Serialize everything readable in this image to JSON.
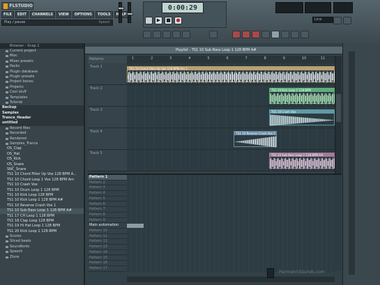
{
  "app": {
    "logo": "FLSTUDIO"
  },
  "menu": [
    "FILE",
    "EDIT",
    "CHANNELS",
    "VIEW",
    "OPTIONS",
    "TOOLS",
    "HELP"
  ],
  "hint_bar": {
    "text": "Play / pause",
    "value": "Speed"
  },
  "transport": {
    "time": "0:00:29",
    "play_symbol": "▶",
    "stop_symbol": "■",
    "record_symbol": "●"
  },
  "line_label": "Line",
  "browser": {
    "header": "Browser - Snap 1",
    "items": [
      {
        "t": "Current project",
        "kind": "folder"
      },
      {
        "t": "Misc",
        "kind": "folder"
      },
      {
        "t": "Mixer presets",
        "kind": "folder"
      },
      {
        "t": "Packs",
        "kind": "folder"
      },
      {
        "t": "Plugin database",
        "kind": "folder"
      },
      {
        "t": "Plugin presets",
        "kind": "folder"
      },
      {
        "t": "Project bones",
        "kind": "folder"
      },
      {
        "t": "Projects",
        "kind": "folder"
      },
      {
        "t": "Cool stuff",
        "kind": "folder"
      },
      {
        "t": "Templates",
        "kind": "folder"
      },
      {
        "t": "Tutorial",
        "kind": "folder"
      },
      {
        "t": "Backup",
        "kind": "root"
      },
      {
        "t": "Samples",
        "kind": "root"
      },
      {
        "t": "Trance_Header",
        "kind": "root"
      },
      {
        "t": "untitled",
        "kind": "root"
      },
      {
        "t": "Record files",
        "kind": "folder"
      },
      {
        "t": "Recorded",
        "kind": "folder"
      },
      {
        "t": "Rendered",
        "kind": "folder"
      },
      {
        "t": "Samples_Trance",
        "kind": "folder"
      },
      {
        "t": "OS_Clap",
        "kind": "file"
      },
      {
        "t": "OS_Hat",
        "kind": "file"
      },
      {
        "t": "OS_Kick",
        "kind": "file"
      },
      {
        "t": "OS_Snare",
        "kind": "file"
      },
      {
        "t": "SNC_Snare",
        "kind": "file"
      },
      {
        "t": "TS1 10 Chord Filter Up Vox 128 BPM A...",
        "kind": "file"
      },
      {
        "t": "TS1 10 Chord Loop 1 Vox 128 BPM Am",
        "kind": "file"
      },
      {
        "t": "TS1 10 Crash Vox",
        "kind": "file"
      },
      {
        "t": "TS1 10 Drum Loop 1 128 BPM",
        "kind": "file"
      },
      {
        "t": "TS1 10 Kick Loop 128 BPM",
        "kind": "file"
      },
      {
        "t": "TS1 10 Kick Loop 1 128 BPM A#",
        "kind": "file"
      },
      {
        "t": "TS1 10 Reverse Crash Vox 1",
        "kind": "file"
      },
      {
        "t": "TS1 10 Sub Bass Loop 1 128 BPM A#",
        "kind": "file",
        "selected": true
      },
      {
        "t": "TS1 17 CH Loop 1 128 BPM",
        "kind": "file"
      },
      {
        "t": "TS1 18 Clap Loop 128 BPM",
        "kind": "file"
      },
      {
        "t": "TS1 19 Hi Hat Loop 1 128 BPM",
        "kind": "file"
      },
      {
        "t": "TS1 20 Kick Loop 1 128 BPM",
        "kind": "file"
      },
      {
        "t": "Scores",
        "kind": "folder"
      },
      {
        "t": "Sliced beats",
        "kind": "folder"
      },
      {
        "t": "Soundfonts",
        "kind": "folder"
      },
      {
        "t": "Speech",
        "kind": "folder"
      },
      {
        "t": "Ztore",
        "kind": "folder"
      }
    ]
  },
  "playlist": {
    "title": "Playlist - TS1 10 Sub Bass Loop 1 128 BPM A#",
    "selector": "Patterns",
    "bar_ticks": [
      "1",
      "2",
      "3",
      "4",
      "5",
      "6",
      "7",
      "8",
      "9",
      "10",
      "11"
    ],
    "tracks": [
      "Track 1",
      "Track 2",
      "Track 3",
      "Track 4",
      "Track 5"
    ],
    "clips": [
      {
        "track": 0,
        "start": 0.0,
        "end": 1.0,
        "label": "TS1 10 Chord Filter Up Vox 128 BPM Am 1",
        "color": "#b8a070",
        "wave": "#e8ecee"
      },
      {
        "track": 1,
        "start": 0.685,
        "end": 1.0,
        "label": "TS1 10 Kick Loop 1 128 BPM",
        "color": "#5fae7a",
        "wave": "#b6f1c2"
      },
      {
        "track": 2,
        "start": 0.685,
        "end": 1.0,
        "label": "TS1 10 Crash Vox",
        "color": "#5f9aa8",
        "wave": "#d8eef2"
      },
      {
        "track": 3,
        "start": 0.515,
        "end": 0.72,
        "label": "TS1 10 Reverse Crash Vox 1",
        "color": "#6a8ba6",
        "wave": "#dde8ef"
      },
      {
        "track": 4,
        "start": 0.685,
        "end": 1.0,
        "label": "TS1 10 Sub Bass Loop 1 128 BPM A#",
        "color": "#a57a9c",
        "wave": "#f0d6ea"
      }
    ],
    "patterns": [
      "Pattern 1",
      "Pattern 2",
      "Pattern 3",
      "Pattern 4",
      "Pattern 5",
      "Pattern 6",
      "Pattern 7",
      "Pattern 8",
      "Pattern 9",
      "Main automation",
      "Pattern 10",
      "Pattern 11",
      "Pattern 12",
      "Pattern 13",
      "Pattern 14",
      "Pattern 15",
      "Pattern 16",
      "Pattern 17"
    ]
  },
  "watermark": "HarmonicSounds.com"
}
